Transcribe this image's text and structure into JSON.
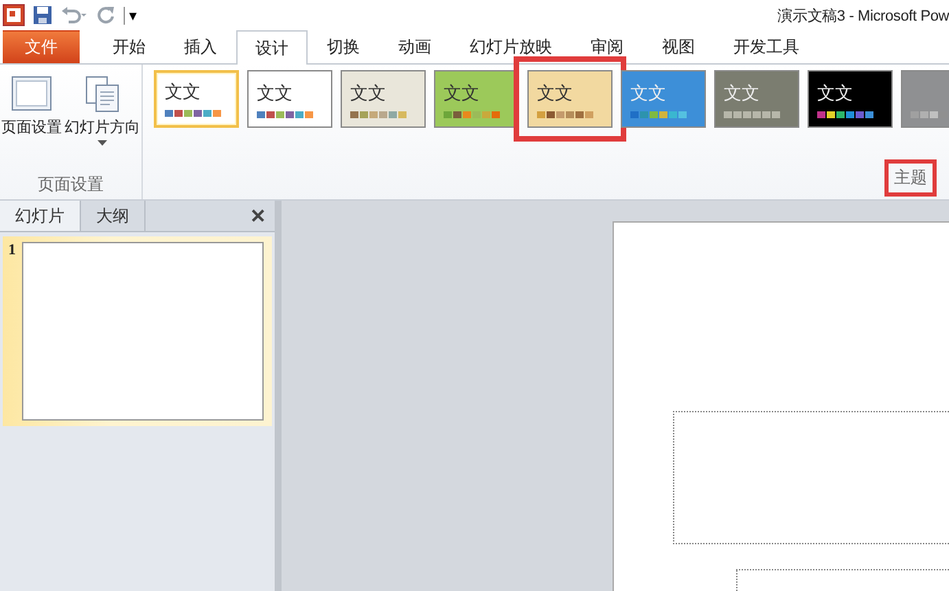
{
  "window": {
    "title": "演示文稿3 - Microsoft Pow"
  },
  "quick_access": [
    "▾"
  ],
  "tabs": [
    {
      "label": "文件",
      "kind": "file",
      "selected": false
    },
    {
      "label": "开始",
      "kind": "tab",
      "selected": false
    },
    {
      "label": "插入",
      "kind": "tab",
      "selected": false
    },
    {
      "label": "设计",
      "kind": "tab",
      "selected": true
    },
    {
      "label": "切换",
      "kind": "tab",
      "selected": false
    },
    {
      "label": "动画",
      "kind": "tab",
      "selected": false
    },
    {
      "label": "幻灯片放映",
      "kind": "tab",
      "selected": false
    },
    {
      "label": "审阅",
      "kind": "tab",
      "selected": false
    },
    {
      "label": "视图",
      "kind": "tab",
      "selected": false
    },
    {
      "label": "开发工具",
      "kind": "tab",
      "selected": false
    }
  ],
  "page_setup_group": {
    "label": "页面设置",
    "buttons": [
      {
        "label": "页面设置",
        "kind": "page",
        "dropdown": false
      },
      {
        "label": "幻灯片方向",
        "kind": "orientation",
        "dropdown": true
      }
    ]
  },
  "themes_group": {
    "label": "主题",
    "highlighted": true,
    "themes": [
      {
        "sample": "文文",
        "color": "#ffffff",
        "selected": true,
        "highlighted": false
      },
      {
        "sample": "文文",
        "color": "#ffffff",
        "selected": false,
        "highlighted": false
      },
      {
        "sample": "文文",
        "color": "#e9e6da",
        "selected": false,
        "highlighted": false
      },
      {
        "sample": "文文",
        "color": "#9cc95a",
        "selected": false,
        "highlighted": false
      },
      {
        "sample": "文文",
        "color": "#f2d9a0",
        "selected": false,
        "highlighted": true
      },
      {
        "sample": "文文",
        "color": "#3d8fd8",
        "selected": false,
        "highlighted": false
      },
      {
        "sample": "文文",
        "color": "#7b7d70",
        "selected": false,
        "highlighted": false
      },
      {
        "sample": "文文",
        "color": "#000000",
        "selected": false,
        "highlighted": false
      },
      {
        "color": "#8f9092",
        "selected": false,
        "highlighted": false
      }
    ]
  },
  "side_panel": {
    "tabs": [
      {
        "label": "幻灯片",
        "selected": true
      },
      {
        "label": "大纲",
        "selected": false
      }
    ],
    "close": "✕",
    "slides": [
      {
        "number": "1",
        "selected": true
      }
    ]
  }
}
